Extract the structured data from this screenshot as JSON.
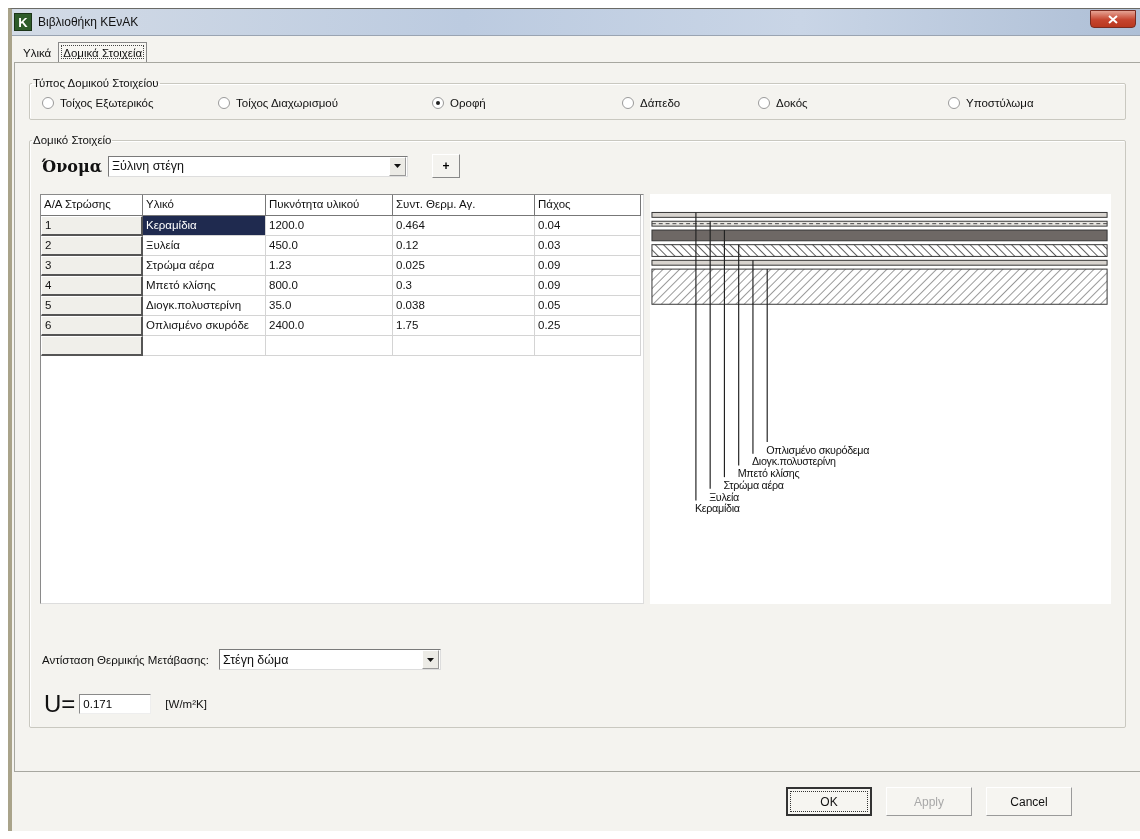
{
  "window": {
    "app_icon": "K",
    "title": "Βιβλιοθήκη ΚΕνΑΚ"
  },
  "tabs": [
    {
      "label": "Υλικά",
      "selected": false
    },
    {
      "label": "Δομικά Στοιχεία",
      "selected": true
    }
  ],
  "element_type": {
    "title": "Τύπος Δομικού Στοιχείου",
    "options": [
      {
        "label": "Τοίχος Εξωτερικός",
        "selected": false
      },
      {
        "label": "Τοίχος Διαχωρισμού",
        "selected": false
      },
      {
        "label": "Οροφή",
        "selected": true
      },
      {
        "label": "Δάπεδο",
        "selected": false
      },
      {
        "label": "Δοκός",
        "selected": false
      },
      {
        "label": "Υποστύλωμα",
        "selected": false
      }
    ]
  },
  "element": {
    "title": "Δομικό Στοιχείο",
    "name_label": "Όνομα",
    "name_value": "Ξύλινη στέγη",
    "add_button": "+",
    "table": {
      "columns": [
        "Α/Α Στρώσης",
        "Υλικό",
        "Πυκνότητα υλικού",
        "Συντ. Θερμ. Αγ.",
        "Πάχος"
      ],
      "rows": [
        {
          "cells": [
            "1",
            "Κεραμίδια",
            "1200.0",
            "0.464",
            "0.04"
          ],
          "selected": true
        },
        {
          "cells": [
            "2",
            "Ξυλεία",
            "450.0",
            "0.12",
            "0.03"
          ],
          "selected": false
        },
        {
          "cells": [
            "3",
            "Στρώμα αέρα",
            "1.23",
            "0.025",
            "0.09"
          ],
          "selected": false
        },
        {
          "cells": [
            "4",
            "Μπετό κλίσης",
            "800.0",
            "0.3",
            "0.09"
          ],
          "selected": false
        },
        {
          "cells": [
            "5",
            "Διογκ.πολυστερίνη",
            "35.0",
            "0.038",
            "0.05"
          ],
          "selected": false
        },
        {
          "cells": [
            "6",
            "Οπλισμένο σκυρόδε",
            "2400.0",
            "1.75",
            "0.25"
          ],
          "selected": false
        }
      ]
    },
    "diagram": {
      "layers": [
        {
          "kind": "plain"
        },
        {
          "kind": "dashed"
        },
        {
          "kind": "solid"
        },
        {
          "kind": "hatch-back"
        },
        {
          "kind": "plain"
        },
        {
          "kind": "hatch"
        }
      ],
      "labels": [
        "Οπλισμένο σκυρόδεμα",
        "Διογκ.πολυστερίνη",
        "Μπετό κλίσης",
        "Στρώμα αέρα",
        "Ξυλεία",
        "Κεραμίδια"
      ]
    },
    "resistance": {
      "label": "Αντίσταση Θερμικής Μετάβασης:",
      "value": "Στέγη δώμα"
    },
    "u": {
      "label": "U=",
      "value": "0.171",
      "unit": "[W/m²K]"
    }
  },
  "buttons": [
    {
      "label": "OK",
      "kind": "default",
      "disabled": false
    },
    {
      "label": "Apply",
      "kind": "normal",
      "disabled": true
    },
    {
      "label": "Cancel",
      "kind": "normal",
      "disabled": false
    }
  ]
}
